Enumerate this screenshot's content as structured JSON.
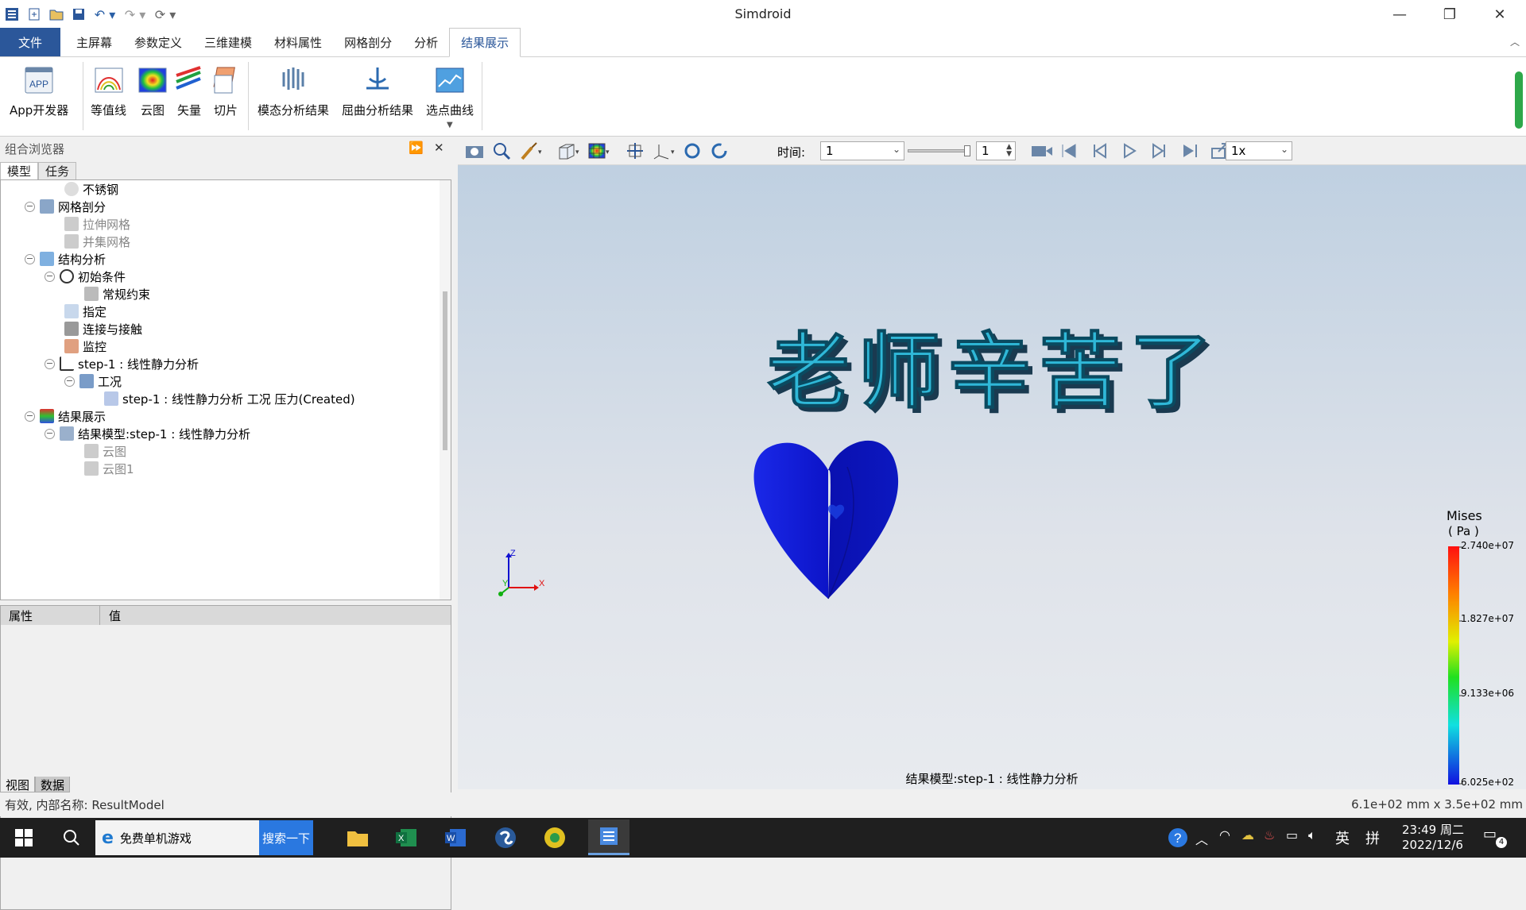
{
  "window": {
    "title": "Simdroid"
  },
  "quick_access": [
    "app-icon",
    "new-icon",
    "open-icon",
    "save-icon",
    "undo-icon",
    "redo-icon",
    "refresh-icon"
  ],
  "tabs": [
    {
      "label": "文件"
    },
    {
      "label": "主屏幕"
    },
    {
      "label": "参数定义"
    },
    {
      "label": "三维建模"
    },
    {
      "label": "材料属性"
    },
    {
      "label": "网格剖分"
    },
    {
      "label": "分析"
    },
    {
      "label": "结果展示"
    }
  ],
  "active_tab": "结果展示",
  "ribbon": {
    "app_dev": "App开发器",
    "app_badge": "APP",
    "contour_line": "等值线",
    "cloud": "云图",
    "vector": "矢量",
    "slice": "切片",
    "modal": "模态分析结果",
    "buckling": "屈曲分析结果",
    "point_curve": "选点曲线"
  },
  "browser": {
    "title": "组合浏览器",
    "tab_model": "模型",
    "tab_task": "任务"
  },
  "tree": [
    {
      "label": "不锈钢",
      "grey": false
    },
    {
      "label": "网格剖分",
      "grey": false
    },
    {
      "label": "拉伸网格",
      "grey": true
    },
    {
      "label": "并集网格",
      "grey": true
    },
    {
      "label": "结构分析",
      "grey": false
    },
    {
      "label": "初始条件",
      "grey": false
    },
    {
      "label": "常规约束",
      "grey": false
    },
    {
      "label": "指定",
      "grey": false
    },
    {
      "label": "连接与接触",
      "grey": false
    },
    {
      "label": "监控",
      "grey": false
    },
    {
      "label": "step-1 : 线性静力分析",
      "grey": false
    },
    {
      "label": "工况",
      "grey": false
    },
    {
      "label": "step-1 : 线性静力分析 工况 压力(Created)",
      "grey": false
    },
    {
      "label": "结果展示",
      "grey": false
    },
    {
      "label": "结果模型:step-1 : 线性静力分析",
      "grey": false
    },
    {
      "label": "云图",
      "grey": true
    },
    {
      "label": "云图1",
      "grey": true
    }
  ],
  "props": {
    "col_prop": "属性",
    "col_value": "值"
  },
  "bottom_tabs": {
    "view": "视图",
    "data": "数据"
  },
  "toolbar": {
    "time_label": "时间:",
    "time_value": "1",
    "step_value": "1",
    "speed": "1x"
  },
  "viewport": {
    "text3d": "老师辛苦了",
    "caption": "结果模型:step-1 : 线性静力分析",
    "axis": {
      "x": "X",
      "y": "Y",
      "z": "Z"
    }
  },
  "legend": {
    "title": "Mises",
    "unit": "( Pa )",
    "ticks": [
      "2.740e+07",
      "1.827e+07",
      "9.133e+06",
      "6.025e+02"
    ]
  },
  "status": {
    "left": "有效, 内部名称: ResultModel",
    "right": "6.1e+02 mm x 3.5e+02 mm"
  },
  "taskbar": {
    "search_text": "免费单机游戏",
    "search_button": "搜索一下",
    "time": "23:49 周二",
    "date": "2022/12/6",
    "lang": "英",
    "ime": "拼",
    "notif_count": "4"
  },
  "colors": {
    "accent": "#2b579a",
    "heart": "#1010d0",
    "text3d": "#2fb8d8"
  }
}
